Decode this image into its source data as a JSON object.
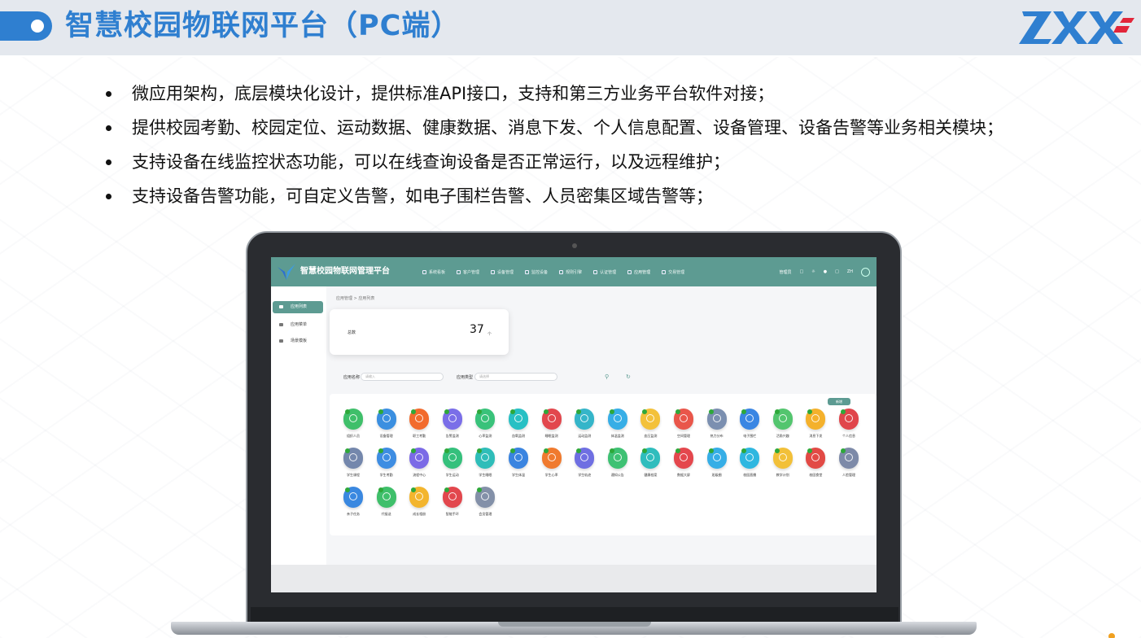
{
  "slide": {
    "title": "智慧校园物联网平台（PC端）",
    "bullets": [
      "微应用架构，底层模块化设计，提供标准API接口，支持和第三方业务平台软件对接；",
      "提供校园考勤、校园定位、运动数据、健康数据、消息下发、个人信息配置、设备管理、设备告警等业务相关模块；",
      "支持设备在线监控状态功能，可以在线查询设备是否正常运行，以及远程维护；",
      "支持设备告警功能，可自定义告警，如电子围栏告警、人员密集区域告警等；"
    ],
    "colors": {
      "accent": "#2f7fd0",
      "header_bg": "#e4e8ee"
    }
  },
  "app": {
    "title": "智慧校园物联网管理平台",
    "nav": [
      {
        "label": "系统看板",
        "icon": "chart-icon"
      },
      {
        "label": "客户管理",
        "icon": "user-icon"
      },
      {
        "label": "设备管理",
        "icon": "device-icon"
      },
      {
        "label": "监控设备",
        "icon": "monitor-icon"
      },
      {
        "label": "规则引擎",
        "icon": "rule-icon"
      },
      {
        "label": "认证管理",
        "icon": "cert-icon"
      },
      {
        "label": "应用管理",
        "icon": "app-icon",
        "active": true
      },
      {
        "label": "交易管理",
        "icon": "trade-icon"
      }
    ],
    "top_right": {
      "user": "管理员",
      "lang": "ZH"
    },
    "sidebar": [
      {
        "label": "应用列表",
        "active": true
      },
      {
        "label": "应用菜单"
      },
      {
        "label": "场景模板"
      }
    ],
    "breadcrumb": "应用管理  >  应用列表",
    "total": {
      "label": "总数",
      "value": "37",
      "unit": "个"
    },
    "filters": {
      "name_label": "应用名称",
      "name_placeholder": "请输入",
      "type_label": "应用类型",
      "type_placeholder": "请选择"
    },
    "new_button": "新增",
    "colors": {
      "primary": "#5d9b92"
    },
    "apps": [
      {
        "name": "组织人员",
        "color": "#3fbf6a"
      },
      {
        "name": "设备管理",
        "color": "#3b8fe0"
      },
      {
        "name": "职工考勤",
        "color": "#f26b2d"
      },
      {
        "name": "告警监测",
        "color": "#7a6ee8"
      },
      {
        "name": "心率监测",
        "color": "#39c27a"
      },
      {
        "name": "血氧监测",
        "color": "#28c0c4"
      },
      {
        "name": "睡眠监测",
        "color": "#e2474d"
      },
      {
        "name": "运动监测",
        "color": "#35b5c9"
      },
      {
        "name": "体温监测",
        "color": "#37aee6"
      },
      {
        "name": "血压监测",
        "color": "#f3c13a"
      },
      {
        "name": "空间管理",
        "color": "#e9564a"
      },
      {
        "name": "热力分布",
        "color": "#7b8fb0"
      },
      {
        "name": "电子围栏",
        "color": "#3a86e3"
      },
      {
        "name": "活角兴趣",
        "color": "#53c56e"
      },
      {
        "name": "消息下发",
        "color": "#f4b12c"
      },
      {
        "name": "个人信息",
        "color": "#e0454b"
      },
      {
        "name": "学生课程",
        "color": "#7487ac"
      },
      {
        "name": "学生考勤",
        "color": "#3e8de2"
      },
      {
        "name": "流程中心",
        "color": "#7b6ae6"
      },
      {
        "name": "学生运动",
        "color": "#35c07c"
      },
      {
        "name": "学生睡眠",
        "color": "#2fbdb9"
      },
      {
        "name": "学生体温",
        "color": "#3a84e0"
      },
      {
        "name": "学生心率",
        "color": "#f07a2e"
      },
      {
        "name": "学生轨迹",
        "color": "#6f6fe2"
      },
      {
        "name": "通知公告",
        "color": "#3ec173"
      },
      {
        "name": "健康档案",
        "color": "#2fbdbd"
      },
      {
        "name": "数据大屏",
        "color": "#e4474d"
      },
      {
        "name": "班级圈",
        "color": "#36aee6"
      },
      {
        "name": "校园直播",
        "color": "#2fb7e0"
      },
      {
        "name": "教学计划",
        "color": "#f2c039"
      },
      {
        "name": "校园食堂",
        "color": "#e24a45"
      },
      {
        "name": "人脸管理",
        "color": "#7d8aa8"
      },
      {
        "name": "亲子任务",
        "color": "#3a88e0"
      },
      {
        "name": "代接送",
        "color": "#3fbf6a"
      },
      {
        "name": "成长相册",
        "color": "#f3b52e"
      },
      {
        "name": "智能手环",
        "color": "#e2474d"
      },
      {
        "name": "会员管理",
        "color": "#8390a8"
      }
    ]
  }
}
